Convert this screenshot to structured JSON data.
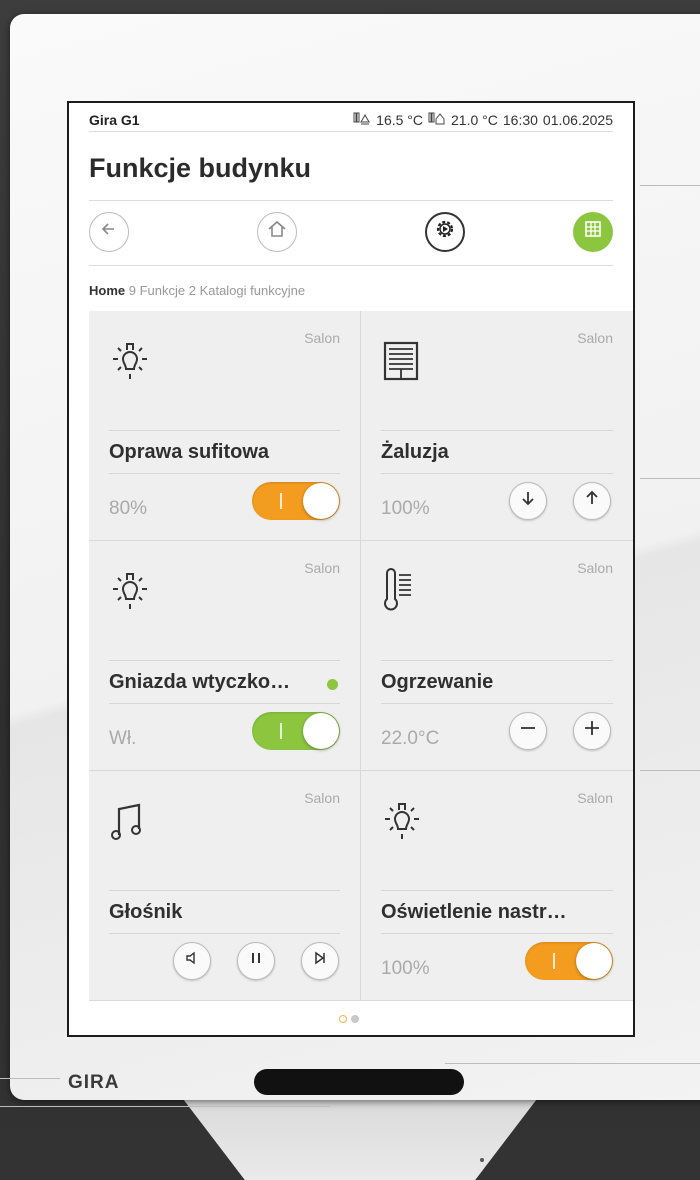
{
  "device": {
    "logo": "GIRA"
  },
  "status": {
    "brand": "Gira G1",
    "outdoor_icon": "thermometer-outdoor-icon",
    "outdoor_temp": "16.5 °C",
    "indoor_icon": "thermometer-indoor-icon",
    "indoor_temp": "21.0 °C",
    "time": "16:30",
    "date": "01.06.2025"
  },
  "page_title": "Funkcje budynku",
  "nav": {
    "back_icon": "arrow-left-icon",
    "home_icon": "home-icon",
    "scenes_icon": "gear-play-icon",
    "grid_icon": "grid-icon"
  },
  "breadcrumb": {
    "home": "Home",
    "rest": "9 Funkcje 2 Katalogi funkcyjne"
  },
  "tiles": [
    {
      "room": "Salon",
      "icon": "bulb-icon",
      "name": "Oprawa sufitowa",
      "value": "80%",
      "control": "toggle",
      "state": "on",
      "accent": "#f39c1f"
    },
    {
      "room": "Salon",
      "icon": "blind-icon",
      "name": "Żaluzja",
      "value": "100%",
      "control": "up-down"
    },
    {
      "room": "Salon",
      "icon": "bulb-icon",
      "name": "Gniazda wtyczko…",
      "value": "Wł.",
      "control": "toggle",
      "state": "on",
      "accent": "#8cc63f",
      "indicator": "green-dot"
    },
    {
      "room": "Salon",
      "icon": "thermometer-icon",
      "name": "Ogrzewanie",
      "value": "22.0°C",
      "control": "minus-plus"
    },
    {
      "room": "Salon",
      "icon": "music-note-icon",
      "name": "Głośnik",
      "value": "",
      "control": "media"
    },
    {
      "room": "Salon",
      "icon": "bulb-icon",
      "name": "Oświetlenie nastr…",
      "value": "100%",
      "control": "toggle",
      "state": "on",
      "accent": "#f39c1f"
    }
  ],
  "pager": {
    "pages": 2,
    "current": 1
  }
}
